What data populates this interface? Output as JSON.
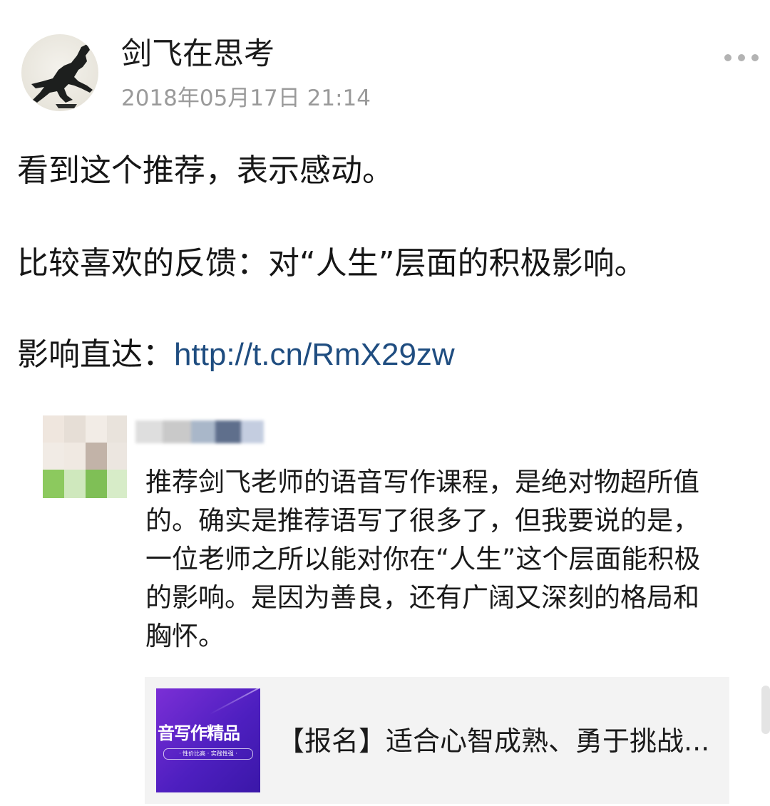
{
  "post": {
    "author_name": "剑飞在思考",
    "timestamp": "2018年05月17日 21:14",
    "body_lines": [
      "看到这个推荐，表示感动。",
      "比较喜欢的反馈：对“人生”层面的积极影响。",
      "影响直达："
    ],
    "short_link": "http://t.cn/RmX29zw"
  },
  "quoted": {
    "text": "推荐剑飞老师的语音写作课程，是绝对物超所值的。确实是推荐语写了很多了，但我要说的是，一位老师之所以能对你在“人生”这个层面能积极的影响。是因为善良，还有广阔又深刻的格局和胸怀。"
  },
  "link_card": {
    "thumbnail_title": "音写作精品",
    "thumbnail_subtitle": "· 性价比高 · 实践性强 ·",
    "title": "【报名】适合心智成熟、勇于挑战..."
  },
  "icons": {
    "avatar": "horse-statue-avatar",
    "more": "more-dots-icon"
  },
  "colors": {
    "link": "#1f4d80",
    "timestamp": "#9a9a9a",
    "card_background": "#f3f3f3",
    "thumbnail": "#5a22c8"
  }
}
